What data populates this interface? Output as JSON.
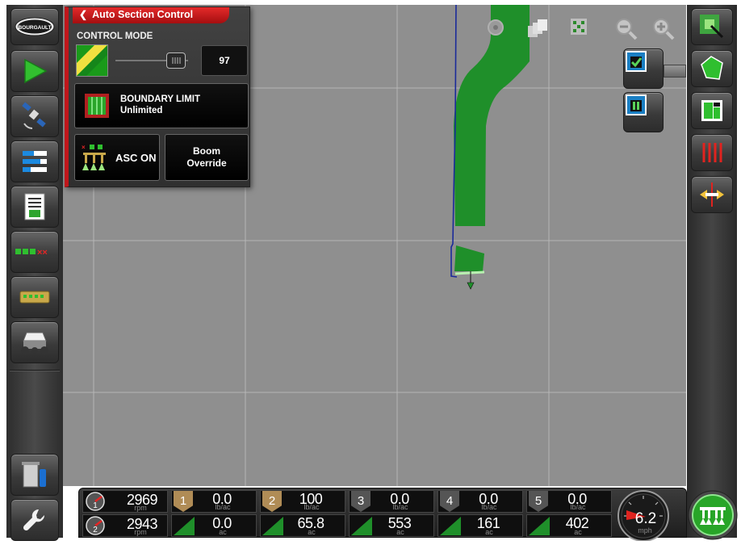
{
  "asc_panel": {
    "title": "Auto Section Control",
    "control_mode_label": "CONTROL MODE",
    "control_mode_value": "97",
    "boundary_title": "BOUNDARY LIMIT",
    "boundary_value": "Unlimited",
    "asc_toggle_label": "ASC ON",
    "boom_override_line1": "Boom",
    "boom_override_line2": "Override"
  },
  "left_rail": {
    "logo_text": "BOURGAULT"
  },
  "status_bar": {
    "rpm": [
      {
        "badge": "1",
        "value": "2969",
        "unit": "rpm"
      },
      {
        "badge": "2",
        "value": "2943",
        "unit": "rpm"
      }
    ],
    "products": [
      {
        "badge": "1",
        "rate": "0.0",
        "rate_unit": "lb/ac",
        "area": "0.0",
        "area_unit": "ac",
        "color": "#b08c56"
      },
      {
        "badge": "2",
        "rate": "100",
        "rate_unit": "lb/ac",
        "area": "65.8",
        "area_unit": "ac",
        "color": "#b08c56"
      },
      {
        "badge": "3",
        "rate": "0.0",
        "rate_unit": "lb/ac",
        "area": "553",
        "area_unit": "ac",
        "color": "#555555"
      },
      {
        "badge": "4",
        "rate": "0.0",
        "rate_unit": "lb/ac",
        "area": "161",
        "area_unit": "ac",
        "color": "#555555"
      },
      {
        "badge": "5",
        "rate": "0.0",
        "rate_unit": "lb/ac",
        "area": "402",
        "area_unit": "ac",
        "color": "#555555"
      }
    ],
    "speed": "6.2",
    "speed_unit": "mph"
  },
  "colors": {
    "coverage_green": "#1f8f2a",
    "map_background": "#8f8f8f",
    "accent_red": "#c0161b"
  },
  "icons": {
    "left_rail": [
      "bourgault-logo",
      "guidance-arrow-icon",
      "gps-satellite-icon",
      "bars-menu-icon",
      "document-report-icon",
      "section-status-icon",
      "implement-icon",
      "cart-icon",
      "trash-bin-icon",
      "wrench-settings-icon"
    ],
    "right_rail": [
      "zoom-select-icon",
      "field-boundary-icon",
      "field-map-icon",
      "sections-icon",
      "pan-arrows-icon"
    ],
    "map_top": [
      "gps-icon",
      "layers-icon",
      "grid-icon",
      "zoom-out-icon",
      "zoom-in-icon"
    ],
    "map_actions": [
      "check-document-icon",
      "pause-document-icon"
    ]
  }
}
